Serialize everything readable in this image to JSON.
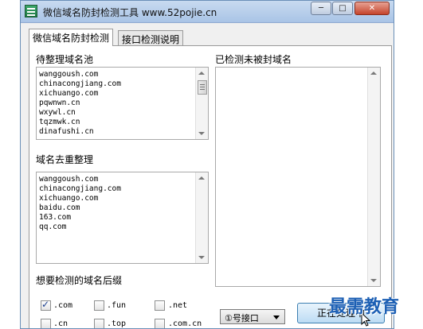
{
  "window": {
    "title": "微信域名防封检测工具 www.52pojie.cn",
    "min_glyph": "─",
    "max_glyph": "□",
    "close_glyph": "✕"
  },
  "tabs": [
    {
      "label": "微信域名防封检测",
      "active": true
    },
    {
      "label": "接口检测说明",
      "active": false
    }
  ],
  "pending_pool": {
    "label": "待整理域名池",
    "items": [
      "wanggoush.com",
      "chinacongjiang.com",
      "xichuango.com",
      "pqwnwn.cn",
      "wxywl.cn",
      "tqzmwk.cn",
      "dinafushi.cn"
    ]
  },
  "dedupe": {
    "label": "域名去重整理",
    "items": [
      "wanggoush.com",
      "chinacongjiang.com",
      "xichuango.com",
      "baidu.com",
      "163.com",
      "qq.com"
    ]
  },
  "unblocked": {
    "label": "已检测未被封域名",
    "items": []
  },
  "suffixes": {
    "label": "想要检测的域名后缀",
    "options": [
      {
        "label": ".com",
        "checked": true
      },
      {
        "label": ".fun",
        "checked": false
      },
      {
        "label": ".net",
        "checked": false
      },
      {
        "label": ".cn",
        "checked": false
      },
      {
        "label": ".top",
        "checked": false
      },
      {
        "label": ".com.cn",
        "checked": false
      }
    ]
  },
  "interface_select": {
    "value": "①号接口"
  },
  "start_button": {
    "label": "正在处理中"
  },
  "watermark": "最需教育",
  "colors": {
    "title_bar": "#b7cfec",
    "close_button": "#c5452c",
    "watermark": "#1c5fb4"
  }
}
